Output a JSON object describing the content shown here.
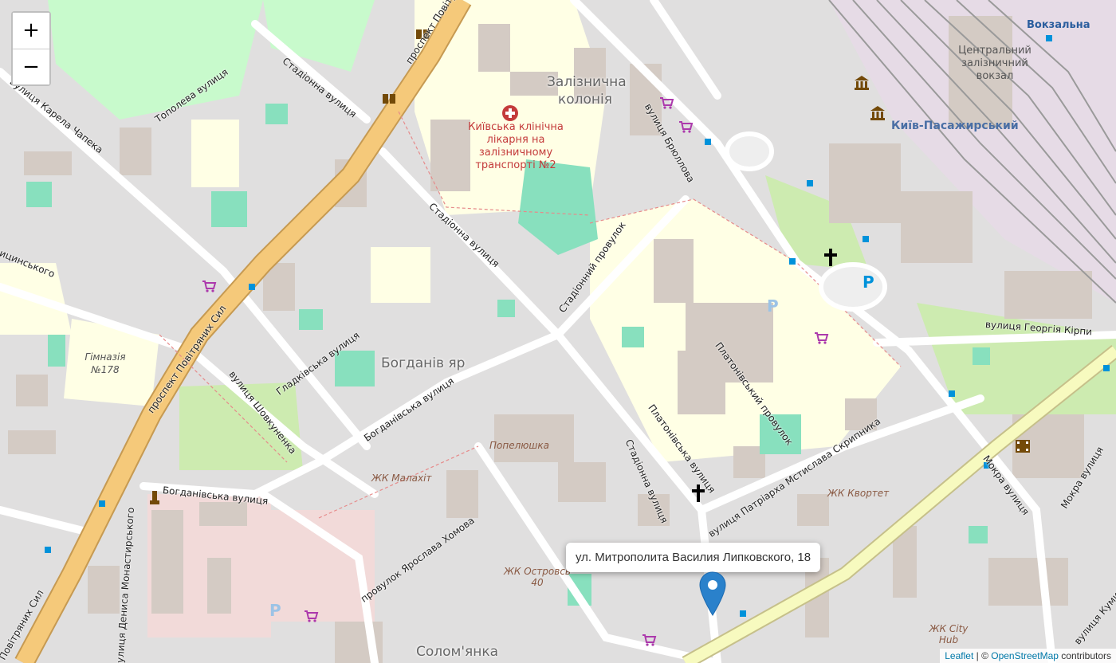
{
  "controls": {
    "zoom_in": "+",
    "zoom_out": "−"
  },
  "popup": {
    "address": "ул. Митрополита Василия Липковского, 18"
  },
  "attribution": {
    "leaflet": "Leaflet",
    "separator": " | © ",
    "osm": "OpenStreetMap",
    "suffix": " contributors"
  },
  "labels": {
    "avenue_top": "проспект Повітряних Сил",
    "avenue_mid": "проспект Повітряних Сил",
    "avenue_bottom": "Повітряних Сил",
    "karela_chapeka": "вулиця Карела Чапека",
    "topoleva": "Тополева вулиця",
    "stadionna_top": "Стадіонна вулиця",
    "stadionna_mid": "Стадіонна вулиця",
    "stadionna_bottom": "Стадіонна вулиця",
    "zaliznychna_koloniia": "Залізнична колонія",
    "hospital": "Київська клінічна лікарня на залізничному транспорті №2",
    "briullova": "вулиця Брюллова",
    "central_station": "Центральний залізничний вокзал",
    "kyiv_pasazhyrskyi": "Київ-Пасажирський",
    "vokzalna": "Вокзальна",
    "stadionnyi_provulok": "Стадіонний провулок",
    "hladkivska": "Гладківська вулиця",
    "bohdaniv_yar": "Богданів яр",
    "shovkunenka": "вулиця Шовкуненка",
    "bohdanivska_mid": "Богданівська вулиця",
    "bohdanivska_bottom": "Богданівська вулиця",
    "platonivskyi_provulok": "Платонівський провулок",
    "platonivska": "Платонівська вулиця",
    "patriarkha": "вулиця Патріарха Мстислава Скрипника",
    "heorhiia_kirpy": "вулиця Георгія Кірпи",
    "mokra_1": "Мокра вулиця",
    "mokra_2": "Мокра вулиця",
    "popeliushka": "Попелюшка",
    "zhk_malakhit": "ЖК Малахіт",
    "zhk_kvortet": "ЖК Квортет",
    "zhk_ostrovskyi": "ЖК Островсь 40",
    "zhk_city_hub": "ЖК City Hub",
    "yaroslava_khomova": "провулок Ярослава Хомова",
    "denysa_monastyrskoho": "вулиця Дениса Монастирського",
    "gymnasium": "Гімназія №178",
    "solomianka": "Солом'янка",
    "lutsynskoho": "ицинського",
    "kumy": "вулиця Куми"
  },
  "colors": {
    "background": "#e0dfdf",
    "residential": "#dddcdc",
    "building": "#d4cbc4",
    "park": "#c8facc",
    "grass": "#cdebb0",
    "school": "#ffffe5",
    "pitch": "#88e0be",
    "trunk_road": "#f5c97a",
    "rail": "#aaaaaa",
    "marker": "#2a81cb"
  },
  "icons": [
    "hospital-icon",
    "library-icon",
    "shop-icon",
    "church-icon",
    "parking-icon",
    "museum-icon",
    "cinema-icon",
    "monument-icon",
    "bus-stop-icon",
    "map-marker-icon"
  ]
}
